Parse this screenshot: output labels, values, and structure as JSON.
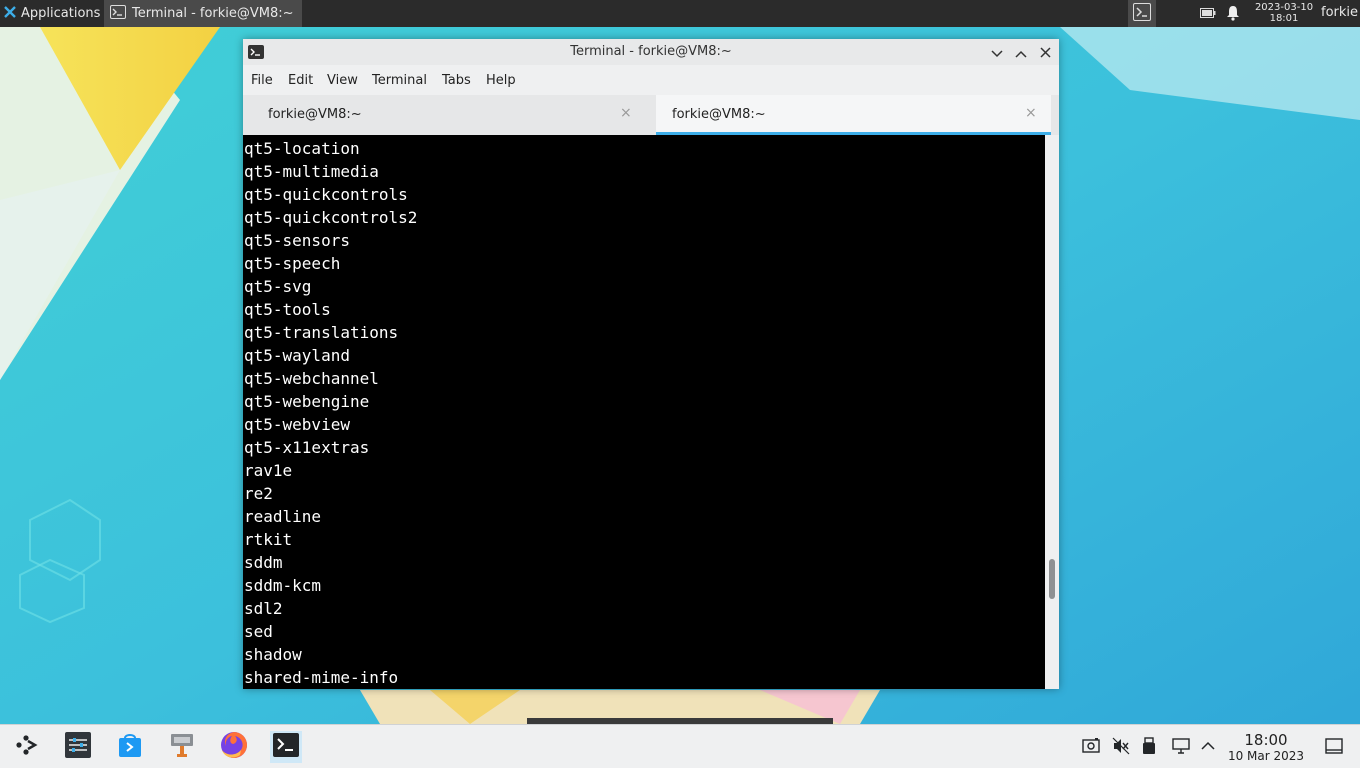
{
  "top_panel": {
    "applications_label": "Applications",
    "task_label": "Terminal - forkie@VM8:~",
    "date": "2023-03-10",
    "time": "18:01",
    "user": "forkie"
  },
  "window": {
    "title": "Terminal - forkie@VM8:~",
    "menu": [
      "File",
      "Edit",
      "View",
      "Terminal",
      "Tabs",
      "Help"
    ],
    "tabs": [
      {
        "label": "forkie@VM8:~",
        "active": false
      },
      {
        "label": "forkie@VM8:~",
        "active": true
      }
    ],
    "tab_close_glyph": "×"
  },
  "terminal": {
    "lines": [
      "qt5-location",
      "qt5-multimedia",
      "qt5-quickcontrols",
      "qt5-quickcontrols2",
      "qt5-sensors",
      "qt5-speech",
      "qt5-svg",
      "qt5-tools",
      "qt5-translations",
      "qt5-wayland",
      "qt5-webchannel",
      "qt5-webengine",
      "qt5-webview",
      "qt5-x11extras",
      "rav1e",
      "re2",
      "readline",
      "rtkit",
      "sddm",
      "sddm-kcm",
      "sdl2",
      "sed",
      "shadow",
      "shared-mime-info"
    ]
  },
  "bottom_panel": {
    "time": "18:00",
    "date": "10 Mar 2023",
    "launchers": [
      "app-launcher-icon",
      "system-settings-icon",
      "discover-store-icon",
      "file-manager-icon",
      "firefox-icon",
      "terminal-icon"
    ],
    "tray": [
      "screenshot-icon",
      "volume-muted-icon",
      "usb-icon",
      "network-icon",
      "expand-tray-icon",
      "show-desktop-icon"
    ]
  },
  "colors": {
    "accent": "#3daee9",
    "terminal_bg": "#000000",
    "terminal_fg": "#ffffff",
    "top_panel_bg": "#2b2b2b"
  }
}
